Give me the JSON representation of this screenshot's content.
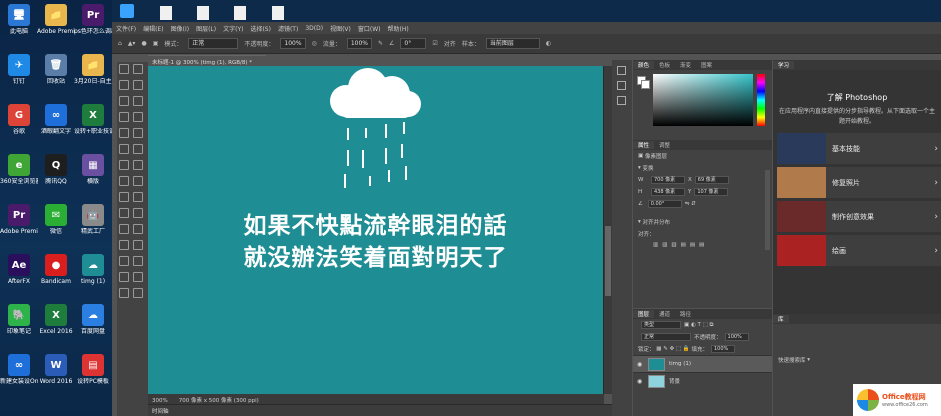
{
  "desktop": {
    "icons": [
      {
        "label": "此电脑",
        "color": "#2b78d4",
        "glyph": "🖥"
      },
      {
        "label": "Adobe Premier...",
        "color": "#e8b64c",
        "glyph": "📁"
      },
      {
        "label": "ps色环怎么调出来2",
        "color": "#4a1a6b",
        "glyph": "Pr"
      },
      {
        "label": "钉钉",
        "color": "#1e8ae6",
        "glyph": "✈"
      },
      {
        "label": "回收站",
        "color": "#5a7ea8",
        "glyph": "🗑"
      },
      {
        "label": "3月20日-自主词包第7...",
        "color": "#e8b64c",
        "glyph": "📁"
      },
      {
        "label": "谷歌",
        "color": "#db4437",
        "glyph": "G"
      },
      {
        "label": "酒眼翻文字",
        "color": "#1e6fd9",
        "glyph": "∞"
      },
      {
        "label": "设转+职业技训+第4批...",
        "color": "#1e7d3c",
        "glyph": "X"
      },
      {
        "label": "360安全浏览器",
        "color": "#3fa535",
        "glyph": "e"
      },
      {
        "label": "腾讯QQ",
        "color": "#1e1e1e",
        "glyph": "Q"
      },
      {
        "label": "横版",
        "color": "#6b4fa0",
        "glyph": "▦"
      },
      {
        "label": "Adobe Premie...",
        "color": "#4a1a6b",
        "glyph": "Pr"
      },
      {
        "label": "微信",
        "color": "#2aae34",
        "glyph": "✉"
      },
      {
        "label": "精武工厂",
        "color": "#8a8a8a",
        "glyph": "🤖"
      },
      {
        "label": "AfterFX",
        "color": "#2a0f5c",
        "glyph": "Ae"
      },
      {
        "label": "Bandicam",
        "color": "#d91e1e",
        "glyph": "●"
      },
      {
        "label": "timg (1)",
        "color": "#1f8d94",
        "glyph": "☁"
      },
      {
        "label": "印象笔记",
        "color": "#2db34a",
        "glyph": "🐘"
      },
      {
        "label": "Excel 2016",
        "color": "#1e7d3c",
        "glyph": "X"
      },
      {
        "label": "百度网盘",
        "color": "#2a7fe0",
        "glyph": "☁"
      },
      {
        "label": "新建女装设Online",
        "color": "#1e6fd9",
        "glyph": "∞"
      },
      {
        "label": "Word 2016",
        "color": "#2b5cb8",
        "glyph": "W"
      },
      {
        "label": "设转PC模板",
        "color": "#d33",
        "glyph": "▤"
      }
    ]
  },
  "menu": [
    "文件(F)",
    "编辑(E)",
    "图像(I)",
    "图层(L)",
    "文字(Y)",
    "选择(S)",
    "滤镜(T)",
    "3D(D)",
    "视图(V)",
    "窗口(W)",
    "帮助(H)"
  ],
  "options": {
    "mode_label": "模式：",
    "mode": "正常",
    "opacity_label": "不透明度：",
    "opacity": "100%",
    "flow_label": "流量：",
    "flow": "100%",
    "angle": "0°",
    "align_label": "对齐",
    "sample_label": "样本：",
    "sample": "当前图层"
  },
  "document": {
    "tab": "未标题-1 @ 300% (timg (1), RGB/8) *",
    "caption_line1": "如果不快點流幹眼泪的話",
    "caption_line2": "就没辦法笑着面對明天了",
    "status": "300%　　700 像素 x 500 像素 (300 ppi)",
    "timeline": "时间轴"
  },
  "color_panel": {
    "tabs": [
      "颜色",
      "色板",
      "渐变",
      "图案"
    ],
    "accent": "#36c6cc"
  },
  "properties": {
    "tabs": [
      "属性",
      "调整"
    ],
    "kind": "像素图层",
    "transform_label": "变换",
    "w_label": "W",
    "w": "700 像素",
    "x_label": "X",
    "x": "69 像素",
    "h_label": "H",
    "h": "438 像素",
    "y_label": "Y",
    "y": "107 像素",
    "angle": "0.00°",
    "align_label": "对齐并分布",
    "align_sub": "对齐："
  },
  "layers": {
    "tabs": [
      "图层",
      "通道",
      "路径"
    ],
    "filter_label": "类型",
    "blend": "正常",
    "opacity_label": "不透明度：",
    "opacity": "100%",
    "lock_label": "锁定：",
    "fill_label": "填充：",
    "fill": "100%",
    "items": [
      {
        "name": "timg (1)",
        "thumb": "#1f8d94"
      },
      {
        "name": "背景",
        "thumb": "#8fd3de"
      }
    ]
  },
  "learn": {
    "tab": "学习",
    "title": "了解 Photoshop",
    "desc": "在应用程序内直接提供的分步指导教程。从下面选取一个主题开始教程。",
    "lessons": [
      {
        "label": "基本技能",
        "color": "#2a3a5a"
      },
      {
        "label": "修复照片",
        "color": "#b07a4a"
      },
      {
        "label": "制作创意效果",
        "color": "#6a2a2a"
      },
      {
        "label": "绘画",
        "color": "#a22"
      }
    ]
  },
  "library": {
    "tab": "库",
    "search": "快速搜索库"
  },
  "watermark": {
    "title": "Office教程网",
    "url": "www.office26.com"
  }
}
